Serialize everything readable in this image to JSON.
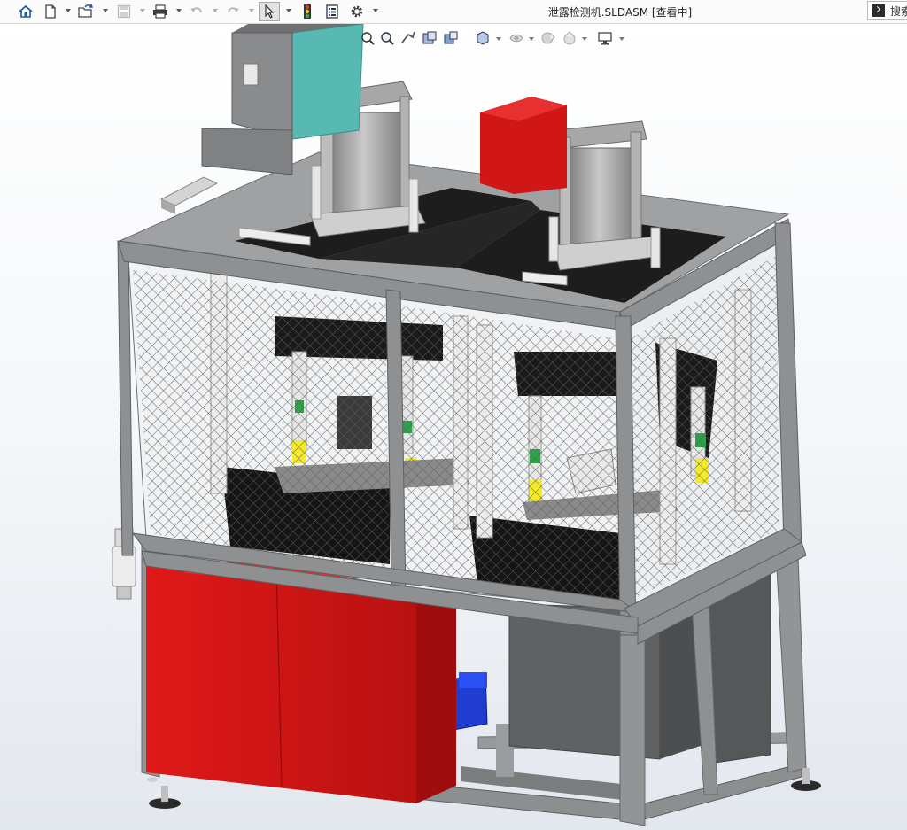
{
  "window": {
    "title": "泄露检测机.SLDASM [查看中]"
  },
  "toolbar": {
    "buttons": [
      {
        "name": "home-button",
        "icon": "home-icon"
      },
      {
        "name": "new-document-button",
        "icon": "new-document-icon"
      },
      {
        "name": "open-button",
        "icon": "open-folder-icon"
      },
      {
        "name": "save-button",
        "icon": "save-icon"
      },
      {
        "name": "print-button",
        "icon": "printer-icon"
      },
      {
        "name": "undo-button",
        "icon": "undo-icon"
      },
      {
        "name": "redo-button",
        "icon": "redo-icon"
      },
      {
        "name": "select-button",
        "icon": "cursor-arrow-icon"
      },
      {
        "name": "rebuild-button",
        "icon": "traffic-light-icon"
      },
      {
        "name": "file-properties-button",
        "icon": "file-properties-icon"
      },
      {
        "name": "options-button",
        "icon": "gear-icon"
      }
    ],
    "search_label": "搜索"
  },
  "heads_up_toolbar": {
    "items": [
      "zoom-to-fit-icon",
      "zoom-area-icon",
      "previous-view-icon",
      "section-view-icon",
      "dynamic-annotation-icon",
      "view-orientation-icon",
      "display-style-icon",
      "hide-show-icon",
      "edit-appearance-icon",
      "apply-scene-icon",
      "view-settings-icon"
    ]
  },
  "colors": {
    "frame": "#8e9092",
    "frame_dark": "#6c6e70",
    "cabinet_red": "#d01616",
    "cabinet_red_dark": "#8e0b0b",
    "top_plate": "#1d1d1d",
    "fixture_black": "#151515",
    "cylinder_gray": "#9b9b9b",
    "teal_box": "#58b9b3",
    "yellow_part": "#f3ea2a",
    "green_part": "#2ea04a",
    "blue_motor": "#1e3fd0",
    "cable_white": "#e8e8e8"
  }
}
